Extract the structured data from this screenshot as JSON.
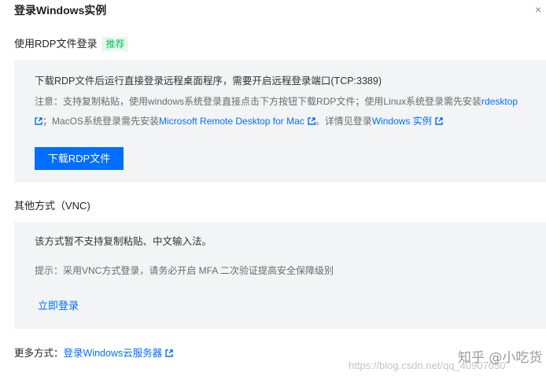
{
  "header": {
    "title": "登录Windows实例",
    "close_glyph": "×"
  },
  "rdp": {
    "title": "使用RDP文件登录",
    "badge": "推荐",
    "description": "下载RDP文件后运行直接登录远程桌面程序，需要开启远程登录端口(TCP:3389)",
    "note_prefix": "注意：支持复制粘贴，使用windows系统登录直接点击下方按钮下载RDP文件；使用Linux系统登录需先安装",
    "link_rdesktop": "rdesktop",
    "note_mac_prefix": "；MacOS系统登录需先安装",
    "link_mac_rdp": "Microsoft Remote Desktop for Mac",
    "note_detail_prefix": "。详情见登录",
    "link_windows_instance": "Windows 实例",
    "download_button": "下载RDP文件"
  },
  "vnc": {
    "title": "其他方式（VNC)",
    "description": "该方式暂不支持复制粘贴、中文输入法。",
    "tip": "提示：采用VNC方式登录，请务必开启 MFA 二次验证提高安全保障级别",
    "login_link": "立即登录"
  },
  "more": {
    "label": "更多方式：",
    "link": "登录Windows云服务器"
  },
  "watermark": {
    "main": "知乎 @小吃货",
    "url": "https://blog.csdn.net/qq_40907050"
  },
  "colors": {
    "accent": "#006eff",
    "badge_text": "#0abf5b",
    "badge_bg": "#e6f9ee",
    "panel_bg": "#f3f4f6"
  },
  "icons": {
    "external_link": "external-link-icon",
    "close": "close-icon"
  }
}
